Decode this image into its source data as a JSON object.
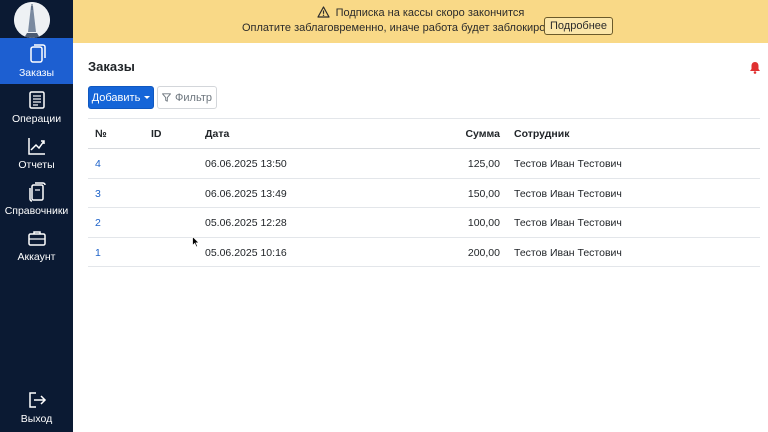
{
  "sidebar": {
    "items": [
      {
        "label": "Заказы",
        "icon": "document-icon",
        "active": true
      },
      {
        "label": "Операции",
        "icon": "list-icon",
        "active": false
      },
      {
        "label": "Отчеты",
        "icon": "chart-icon",
        "active": false
      },
      {
        "label": "Справочники",
        "icon": "books-icon",
        "active": false
      },
      {
        "label": "Аккаунт",
        "icon": "briefcase-icon",
        "active": false
      }
    ],
    "logout": {
      "label": "Выход",
      "icon": "logout-icon"
    }
  },
  "banner": {
    "title": "Подписка на кассы скоро закончится",
    "message": "Оплатите заблаговременно, иначе работа будет заблокирована",
    "button_label": "Подробнее",
    "background": "#f9d987"
  },
  "page": {
    "title": "Заказы",
    "add_label": "Добавить",
    "filter_label": "Фильтр",
    "accent": "#1565d8",
    "bell_color": "#e03131"
  },
  "table": {
    "columns": [
      "№",
      "ID",
      "Дата",
      "Сумма",
      "Сотрудник"
    ],
    "rows": [
      {
        "no": "4",
        "id": "",
        "date": "06.06.2025 13:50",
        "sum": "125,00",
        "employee": "Тестов Иван Тестович"
      },
      {
        "no": "3",
        "id": "",
        "date": "06.06.2025 13:49",
        "sum": "150,00",
        "employee": "Тестов Иван Тестович"
      },
      {
        "no": "2",
        "id": "",
        "date": "05.06.2025 12:28",
        "sum": "100,00",
        "employee": "Тестов Иван Тестович"
      },
      {
        "no": "1",
        "id": "",
        "date": "05.06.2025 10:16",
        "sum": "200,00",
        "employee": "Тестов Иван Тестович"
      }
    ]
  }
}
